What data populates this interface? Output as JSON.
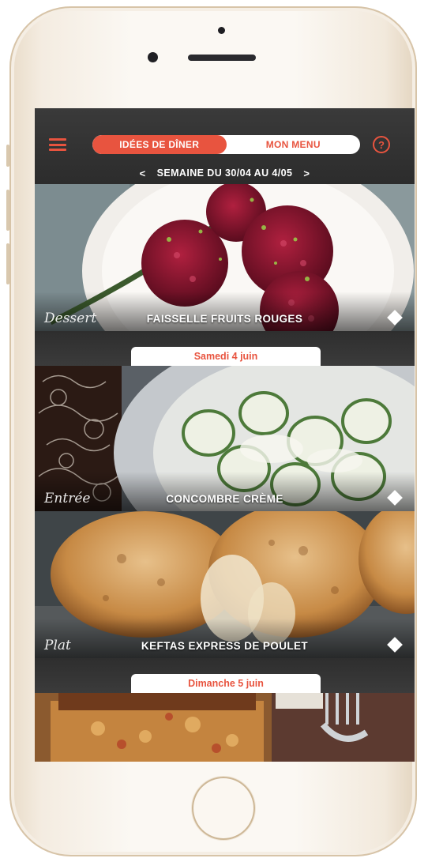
{
  "header": {
    "tabs": [
      {
        "label": "IDÉES DE DÎNER",
        "active": true
      },
      {
        "label": "MON MENU",
        "active": false
      }
    ],
    "help_icon": "question-circle-icon",
    "menu_icon": "hamburger-icon",
    "week": {
      "prev": "<",
      "label": "SEMAINE DU 30/04 AU 4/05",
      "next": ">"
    }
  },
  "cards": [
    {
      "course": "Dessert",
      "dish": "FAISSELLE FRUITS ROUGES"
    },
    {
      "course": "Entrée",
      "dish": "CONCOMBRE CRÈME"
    },
    {
      "course": "Plat",
      "dish": "KEFTAS EXPRESS DE POULET"
    }
  ],
  "days": [
    {
      "label": "Samedi 4 juin"
    },
    {
      "label": "Dimanche 5 juin"
    }
  ],
  "colors": {
    "accent": "#e8543f",
    "header_bg": "#333333",
    "white": "#ffffff"
  }
}
